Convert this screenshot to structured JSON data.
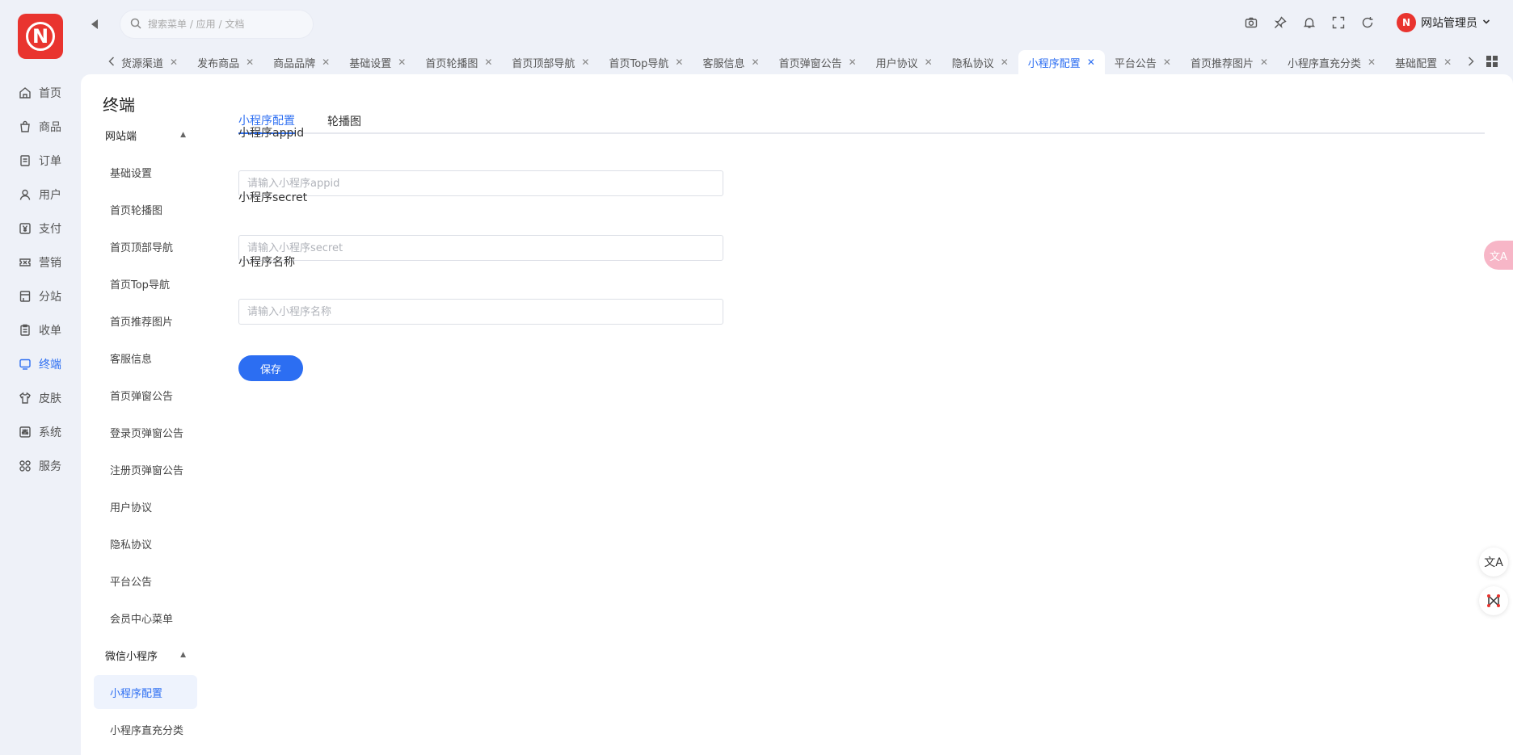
{
  "logo": {
    "letter": "N"
  },
  "nav": {
    "items": [
      {
        "label": "首页",
        "icon": "home-icon"
      },
      {
        "label": "商品",
        "icon": "bag-icon"
      },
      {
        "label": "订单",
        "icon": "order-icon"
      },
      {
        "label": "用户",
        "icon": "user-icon"
      },
      {
        "label": "支付",
        "icon": "yen-icon"
      },
      {
        "label": "营销",
        "icon": "ticket-icon"
      },
      {
        "label": "分站",
        "icon": "branch-icon"
      },
      {
        "label": "收单",
        "icon": "receipt-icon"
      },
      {
        "label": "终端",
        "icon": "monitor-icon",
        "active": true
      },
      {
        "label": "皮肤",
        "icon": "shirt-icon"
      },
      {
        "label": "系统",
        "icon": "sliders-icon"
      },
      {
        "label": "服务",
        "icon": "grid-icon"
      }
    ]
  },
  "search": {
    "placeholder": "搜索菜单 / 应用 / 文档"
  },
  "header": {
    "tools": [
      "camera-icon",
      "pin-icon",
      "bell-icon",
      "fullscreen-icon",
      "refresh-icon"
    ],
    "user_name": "网站管理员",
    "user_avatar_letter": "N"
  },
  "tabs": [
    {
      "label": "货源渠道"
    },
    {
      "label": "发布商品"
    },
    {
      "label": "商品品牌"
    },
    {
      "label": "基础设置"
    },
    {
      "label": "首页轮播图"
    },
    {
      "label": "首页顶部导航"
    },
    {
      "label": "首页Top导航"
    },
    {
      "label": "客服信息"
    },
    {
      "label": "首页弹窗公告"
    },
    {
      "label": "用户协议"
    },
    {
      "label": "隐私协议"
    },
    {
      "label": "小程序配置",
      "active": true
    },
    {
      "label": "平台公告"
    },
    {
      "label": "首页推荐图片"
    },
    {
      "label": "小程序直充分类"
    },
    {
      "label": "基础配置"
    }
  ],
  "panel": {
    "title": "终端",
    "groups": [
      {
        "label": "网站端",
        "items": [
          "基础设置",
          "首页轮播图",
          "首页顶部导航",
          "首页Top导航",
          "首页推荐图片",
          "客服信息",
          "首页弹窗公告",
          "登录页弹窗公告",
          "注册页弹窗公告",
          "用户协议",
          "隐私协议",
          "平台公告",
          "会员中心菜单"
        ]
      },
      {
        "label": "微信小程序",
        "items": [
          "小程序配置",
          "小程序直充分类"
        ]
      }
    ]
  },
  "content": {
    "tabs": [
      "小程序配置",
      "轮播图"
    ],
    "fields": [
      {
        "label": "小程序appid",
        "placeholder": "请输入小程序appid",
        "value": ""
      },
      {
        "label": "小程序secret",
        "placeholder": "请输入小程序secret",
        "value": ""
      },
      {
        "label": "小程序名称",
        "placeholder": "请输入小程序名称",
        "value": ""
      }
    ],
    "save_label": "保存"
  },
  "floats": {
    "pink_text": "文A",
    "translate_text": "文A"
  },
  "colors": {
    "accent": "#2c6ef2",
    "brand": "#e9342f",
    "background": "#eef1f8"
  }
}
